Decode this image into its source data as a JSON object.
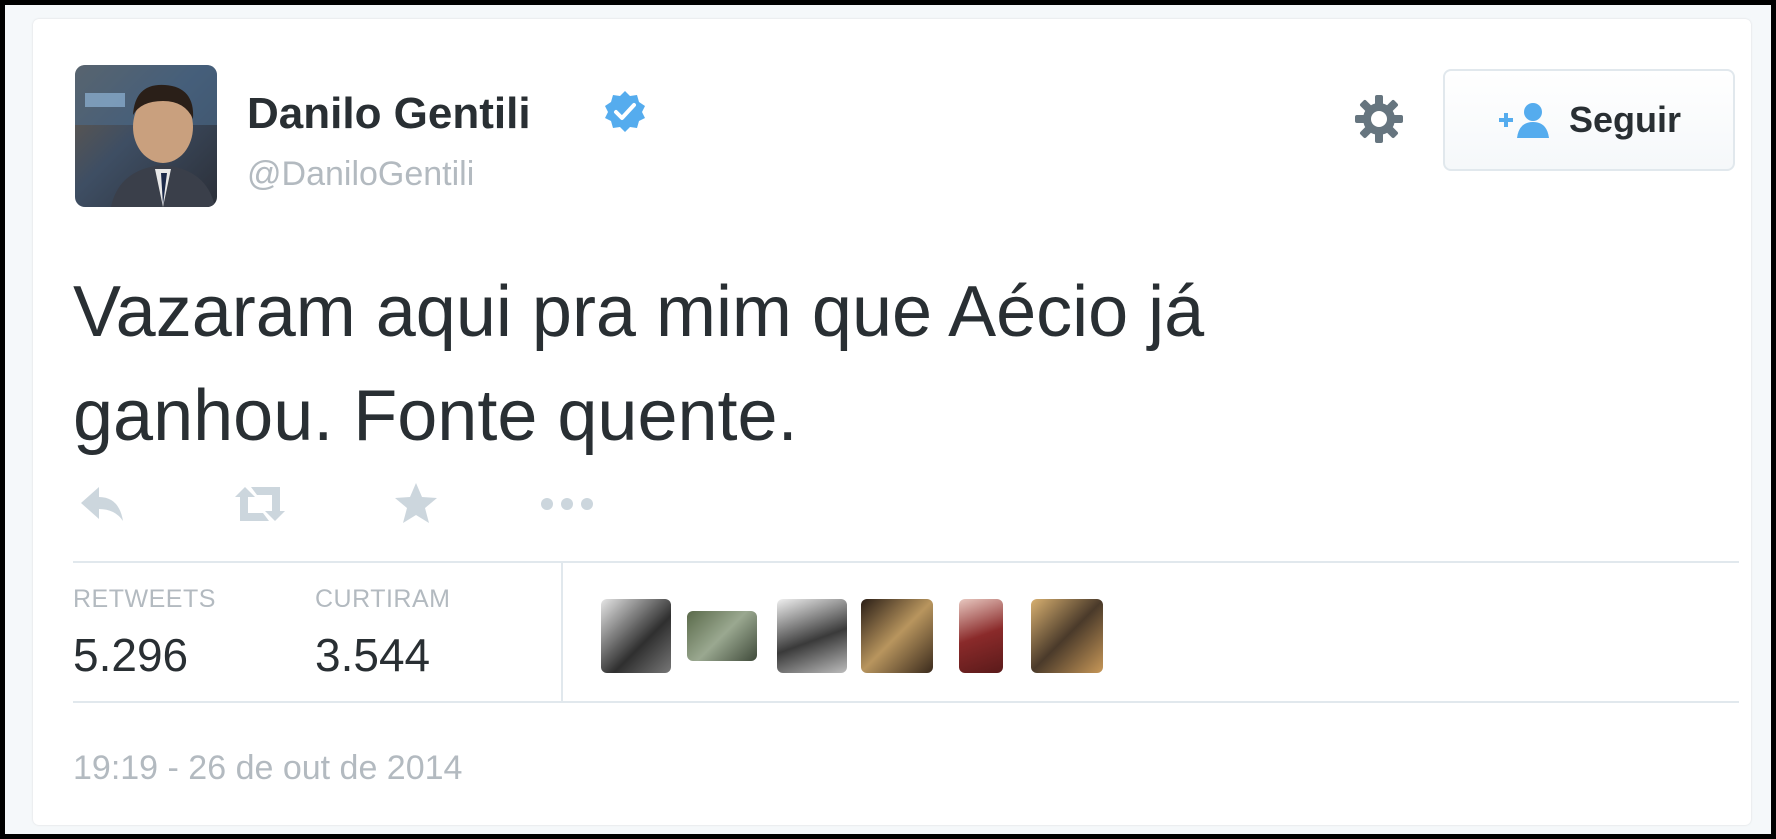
{
  "user": {
    "name": "Danilo Gentili",
    "handle": "@DaniloGentili",
    "verified": true
  },
  "header": {
    "settings_icon": "gear-icon",
    "follow_icon": "add-user-icon",
    "follow_label": "Seguir"
  },
  "tweet": {
    "text": "Vazaram aqui pra mim que Aécio já ganhou. Fonte quente.",
    "timestamp": "19:19 - 26 de out de 2014"
  },
  "actions": [
    {
      "name": "reply-icon"
    },
    {
      "name": "retweet-icon"
    },
    {
      "name": "favorite-icon"
    },
    {
      "name": "more-icon"
    }
  ],
  "stats": {
    "retweets_label": "RETWEETS",
    "retweets_value": "5.296",
    "likes_label": "CURTIRAM",
    "likes_value": "3.544"
  },
  "colors": {
    "text": "#292f33",
    "muted": "#b3bac0",
    "verified": "#55acee",
    "follow_icon": "#55acee",
    "divider": "#e1e8ed"
  }
}
